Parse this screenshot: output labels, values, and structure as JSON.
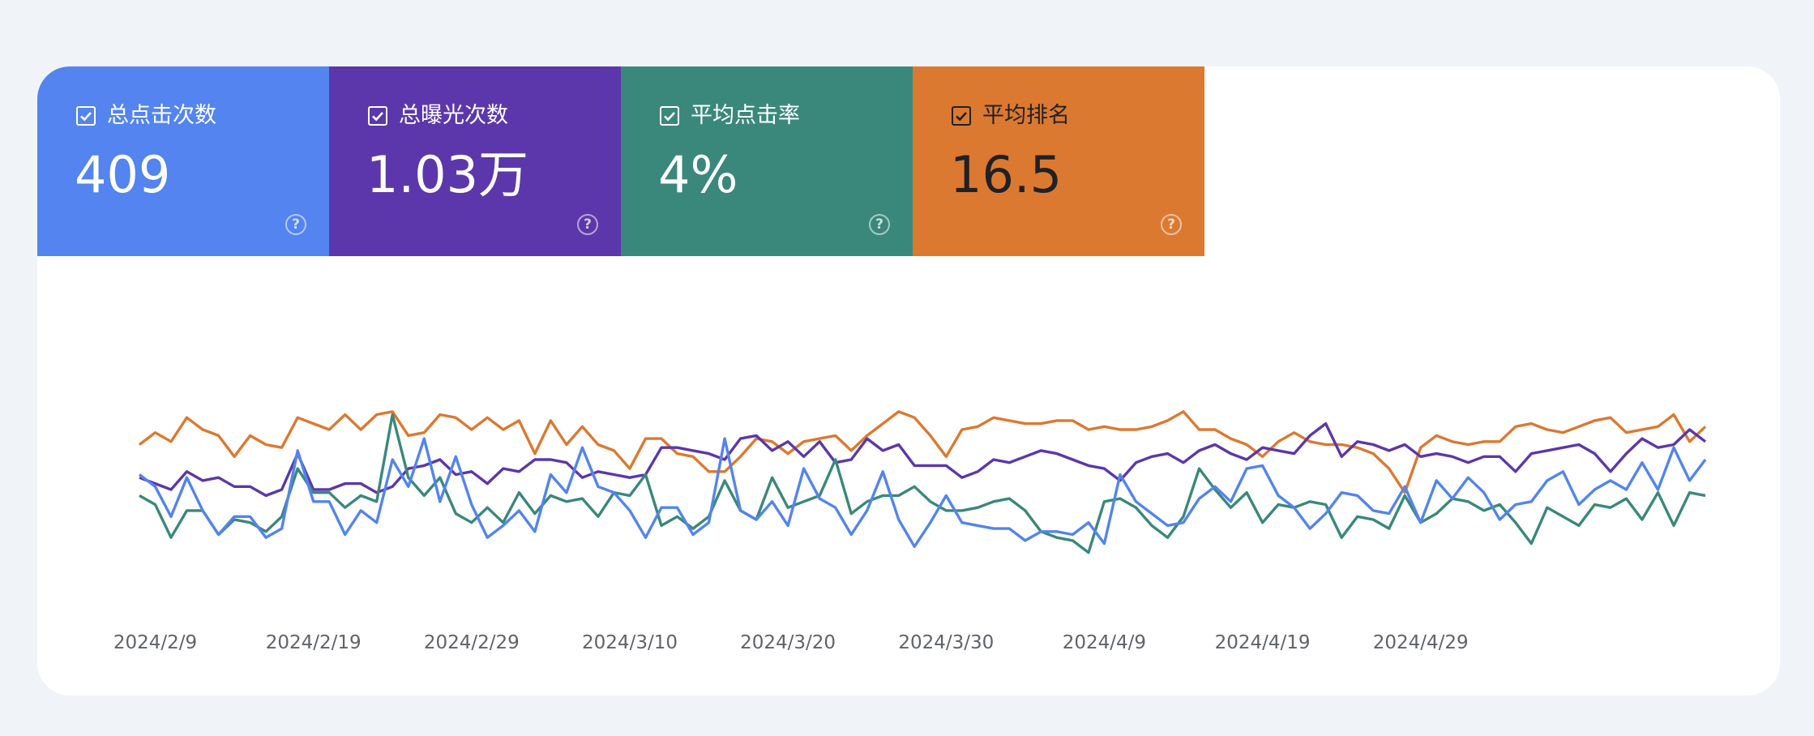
{
  "metrics": [
    {
      "label": "总点击次数",
      "value": "409",
      "color": "#5384ef",
      "text_color": "#ffffff"
    },
    {
      "label": "总曝光次数",
      "value": "1.03万",
      "color": "#5c37ab",
      "text_color": "#ffffff"
    },
    {
      "label": "平均点击率",
      "value": "4%",
      "color": "#3a887b",
      "text_color": "#ffffff"
    },
    {
      "label": "平均排名",
      "value": "16.5",
      "color": "#dc7930",
      "text_color": "#202124"
    }
  ],
  "help_glyph": "?",
  "chart_data": {
    "type": "line",
    "x_start": "2024-02-08",
    "x_tick_labels": [
      "2024/2/9",
      "2024/2/19",
      "2024/2/29",
      "2024/3/10",
      "2024/3/20",
      "2024/3/30",
      "2024/4/9",
      "2024/4/19",
      "2024/4/29"
    ],
    "grid": false,
    "legend": "none",
    "series": [
      {
        "color": "#dc7930",
        "values": [
          55,
          59,
          56,
          64,
          60,
          58,
          51,
          58,
          55,
          54,
          64,
          62,
          60,
          65,
          60,
          65,
          66,
          58,
          59,
          65,
          64,
          60,
          64,
          60,
          63,
          52,
          63,
          55,
          61,
          55,
          53,
          47,
          57,
          57,
          52,
          51,
          46,
          46,
          51,
          57,
          56,
          52,
          56,
          57,
          58,
          53,
          58,
          62,
          66,
          64,
          58,
          51,
          60,
          61,
          64,
          63,
          62,
          62,
          63,
          63,
          60,
          61,
          60,
          60,
          61,
          63,
          66,
          60,
          60,
          57,
          55,
          51,
          56,
          59,
          56,
          55,
          55,
          54,
          52,
          47,
          39,
          54,
          58,
          56,
          55,
          56,
          56,
          61,
          62,
          60,
          59,
          61,
          63,
          64,
          59,
          60,
          61,
          65,
          56,
          61
        ]
      },
      {
        "color": "#5c37ab",
        "values": [
          44,
          42,
          40,
          46,
          43,
          44,
          41,
          41,
          38,
          40,
          52,
          40,
          40,
          42,
          42,
          39,
          41,
          47,
          48,
          50,
          45,
          46,
          42,
          47,
          46,
          50,
          50,
          49,
          44,
          46,
          45,
          44,
          45,
          54,
          54,
          53,
          52,
          50,
          57,
          58,
          53,
          56,
          51,
          56,
          49,
          50,
          57,
          53,
          55,
          48,
          48,
          48,
          44,
          46,
          50,
          49,
          51,
          53,
          52,
          50,
          48,
          47,
          43,
          49,
          51,
          52,
          49,
          53,
          55,
          52,
          50,
          54,
          53,
          52,
          58,
          62,
          51,
          56,
          55,
          53,
          55,
          51,
          52,
          51,
          49,
          51,
          51,
          46,
          52,
          53,
          54,
          55,
          52,
          46,
          52,
          57,
          54,
          55,
          60,
          56
        ]
      },
      {
        "color": "#3a887b",
        "values": [
          38,
          35,
          24,
          33,
          33,
          25,
          30,
          29,
          26,
          31,
          47,
          39,
          39,
          34,
          38,
          36,
          65,
          44,
          38,
          44,
          32,
          29,
          34,
          29,
          39,
          32,
          38,
          36,
          37,
          31,
          39,
          38,
          45,
          28,
          31,
          27,
          31,
          43,
          33,
          30,
          44,
          34,
          36,
          38,
          50,
          32,
          36,
          38,
          38,
          41,
          36,
          33,
          33,
          34,
          36,
          37,
          33,
          26,
          24,
          23,
          19,
          36,
          37,
          34,
          28,
          24,
          31,
          47,
          40,
          34,
          39,
          29,
          35,
          34,
          36,
          35,
          24,
          31,
          30,
          27,
          38,
          29,
          32,
          37,
          36,
          33,
          35,
          29,
          22,
          34,
          31,
          28,
          35,
          34,
          37,
          30,
          39,
          28,
          39,
          38
        ]
      },
      {
        "color": "#5384ef",
        "values": [
          45,
          41,
          31,
          44,
          33,
          25,
          31,
          31,
          24,
          27,
          53,
          36,
          36,
          25,
          33,
          29,
          50,
          41,
          57,
          36,
          51,
          35,
          24,
          28,
          33,
          26,
          45,
          39,
          54,
          41,
          39,
          33,
          24,
          34,
          34,
          25,
          29,
          57,
          33,
          30,
          36,
          28,
          47,
          37,
          34,
          25,
          33,
          46,
          30,
          21,
          29,
          38,
          29,
          28,
          27,
          27,
          23,
          26,
          26,
          25,
          29,
          22,
          45,
          36,
          32,
          28,
          29,
          37,
          41,
          36,
          47,
          48,
          38,
          34,
          27,
          32,
          39,
          38,
          33,
          32,
          41,
          29,
          43,
          37,
          44,
          39,
          30,
          35,
          36,
          43,
          46,
          35,
          40,
          43,
          40,
          49,
          40,
          54,
          43,
          50
        ]
      }
    ]
  }
}
